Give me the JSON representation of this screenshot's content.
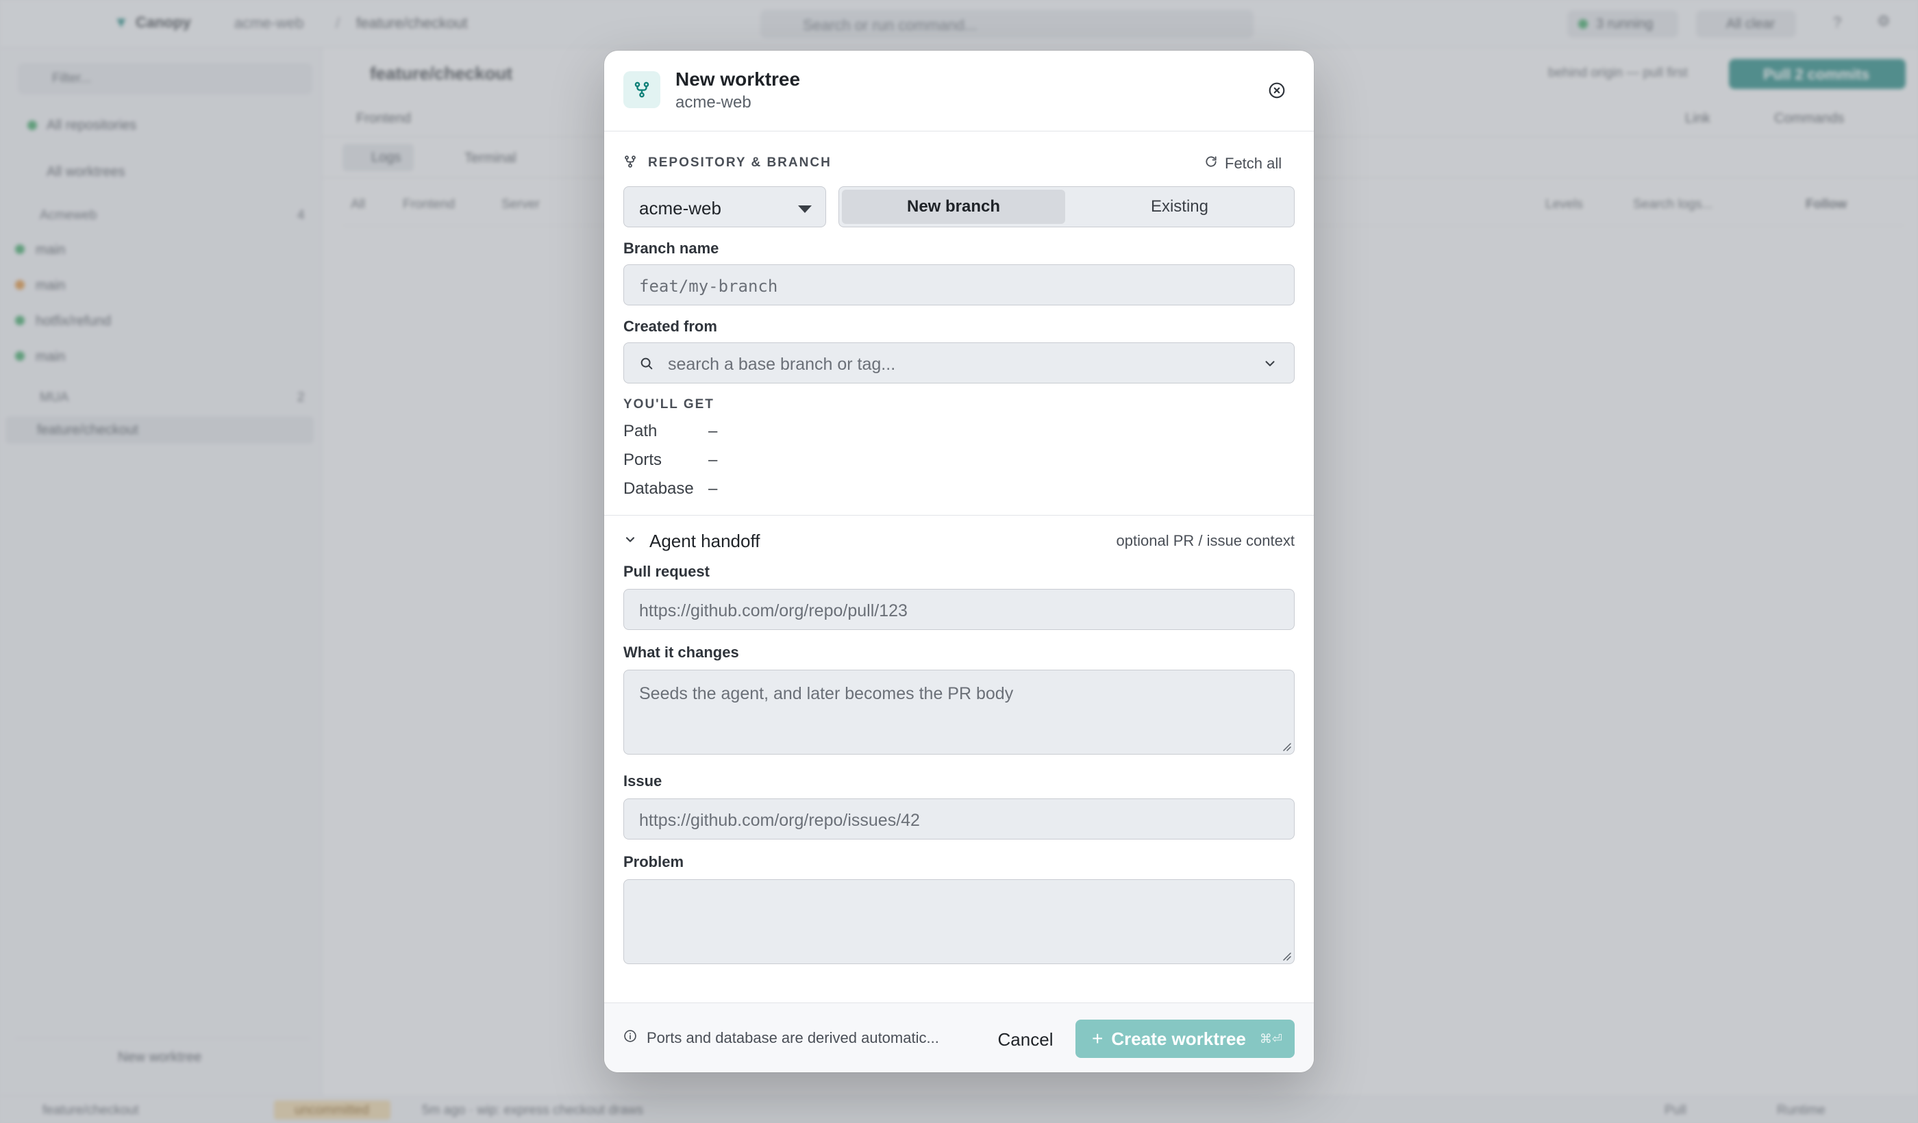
{
  "background": {
    "app_name": "Canopy",
    "crumb_repo": "acme-web",
    "crumb_branch": "feature/checkout",
    "search_placeholder": "Search or run command...",
    "running_label": "3 running",
    "all_clear_label": "All clear",
    "filter_placeholder": "Filter...",
    "all_repositories": "All repositories",
    "all_worktrees": "All worktrees",
    "group_acmeweb": "Acmeweb",
    "group_acmeweb_count": "4",
    "items": [
      {
        "label": "main",
        "color": "#2fa35a"
      },
      {
        "label": "main",
        "color": "#e08a2c"
      },
      {
        "label": "hotfix/refund",
        "color": "#2fa35a"
      },
      {
        "label": "main",
        "color": "#2fa35a"
      }
    ],
    "group_mua": "MUA",
    "group_mua_count": "2",
    "active_item": "feature/checkout",
    "new_worktree": "New worktree",
    "main_title": "feature/checkout",
    "behind_text": "behind origin — pull first",
    "pull_button": "Pull 2 commits",
    "frontend_tab": "Frontend",
    "link_btn": "Link",
    "commands_btn": "Commands",
    "logs_tab": "Logs",
    "terminal_tab": "Terminal",
    "filter_all": "All",
    "filter_frontend": "Frontend",
    "filter_server": "Server",
    "levels": "Levels",
    "search_logs": "Search logs...",
    "follow": "Follow",
    "status_branch": "feature/checkout",
    "status_uncommitted": "uncommitted",
    "status_commit": "5m ago · wip: express checkout draws",
    "status_pull": "Pull",
    "status_runtime": "Runtime"
  },
  "dialog": {
    "title": "New worktree",
    "subtitle": "acme-web",
    "section_repo_branch": "REPOSITORY & BRANCH",
    "fetch_all": "Fetch all",
    "repo_value": "acme-web",
    "branch_mode_new": "New branch",
    "branch_mode_existing": "Existing",
    "branch_name_label": "Branch name",
    "branch_name_placeholder": "feat/my-branch",
    "created_from_label": "Created from",
    "created_from_placeholder": "search a base branch or tag...",
    "youll_get_label": "YOU'LL GET",
    "youll_get": [
      {
        "key": "Path",
        "value": "–"
      },
      {
        "key": "Ports",
        "value": "–"
      },
      {
        "key": "Database",
        "value": "–"
      }
    ],
    "agent_handoff_title": "Agent handoff",
    "agent_handoff_hint": "optional PR / issue context",
    "pull_request_label": "Pull request",
    "pull_request_placeholder": "https://github.com/org/repo/pull/123",
    "what_changes_label": "What it changes",
    "what_changes_placeholder": "Seeds the agent, and later becomes the PR body",
    "issue_label": "Issue",
    "issue_placeholder": "https://github.com/org/repo/issues/42",
    "problem_label": "Problem",
    "problem_placeholder": "",
    "footer_note": "Ports and database are derived automatic...",
    "cancel_label": "Cancel",
    "create_label": "Create worktree",
    "create_shortcut": "⌘⏎"
  },
  "colors": {
    "accent": "#0f8078",
    "accent_disabled": "#86c7c3"
  },
  "icons": {
    "dialog_icon": "git-branch-icon",
    "close": "close-circle-icon",
    "refresh": "refresh-icon",
    "search": "search-icon",
    "chevron": "chevron-down-icon",
    "info": "info-icon"
  }
}
